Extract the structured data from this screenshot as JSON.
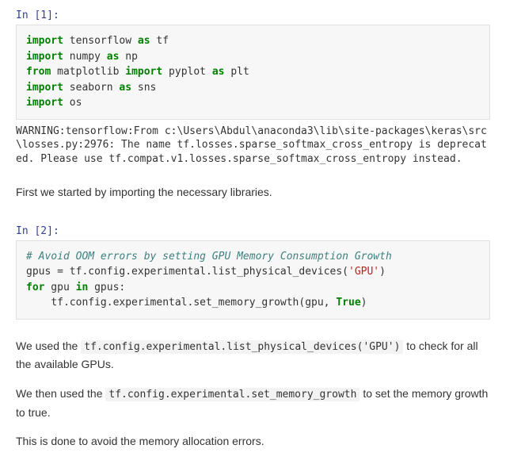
{
  "cell1": {
    "prompt": "In [1]:",
    "line1": {
      "kw": "import",
      "mod": "tensorflow",
      "as": "as",
      "alias": "tf"
    },
    "line2": {
      "kw": "import",
      "mod": "numpy",
      "as": "as",
      "alias": "np"
    },
    "line3": {
      "kw": "from",
      "mod": "matplotlib",
      "imp": "import",
      "obj": "pyplot",
      "as": "as",
      "alias": "plt"
    },
    "line4": {
      "kw": "import",
      "mod": "seaborn",
      "as": "as",
      "alias": "sns"
    },
    "line5": {
      "kw": "import",
      "mod": "os"
    },
    "output": "WARNING:tensorflow:From c:\\Users\\Abdul\\anaconda3\\lib\\site-packages\\keras\\src\\losses.py:2976: The name tf.losses.sparse_softmax_cross_entropy is deprecated. Please use tf.compat.v1.losses.sparse_softmax_cross_entropy instead."
  },
  "md1": {
    "text": "First we started by importing the necessary libraries."
  },
  "cell2": {
    "prompt": "In [2]:",
    "line1": {
      "comment": "# Avoid OOM errors by setting GPU Memory Consumption Growth"
    },
    "line2": {
      "var": "gpus ",
      "eq": "=",
      "call": " tf.config.experimental.list_physical_devices(",
      "str": "'GPU'",
      "close": ")"
    },
    "line3": {
      "kw": "for",
      "v": " gpu ",
      "in": "in",
      "it": " gpus:"
    },
    "line4": {
      "indent": "    ",
      "call": "tf.config.experimental.set_memory_growth(gpu, ",
      "true": "True",
      "close": ")"
    }
  },
  "md2": {
    "pre1": "We used the ",
    "code1": "tf.config.experimental.list_physical_devices('GPU')",
    "post1": " to check for all the available GPUs.",
    "pre2": "We then used the ",
    "code2": "tf.config.experimental.set_memory_growth",
    "post2": " to set the memory growth to true.",
    "p3": "This is done to avoid the memory allocation errors."
  }
}
